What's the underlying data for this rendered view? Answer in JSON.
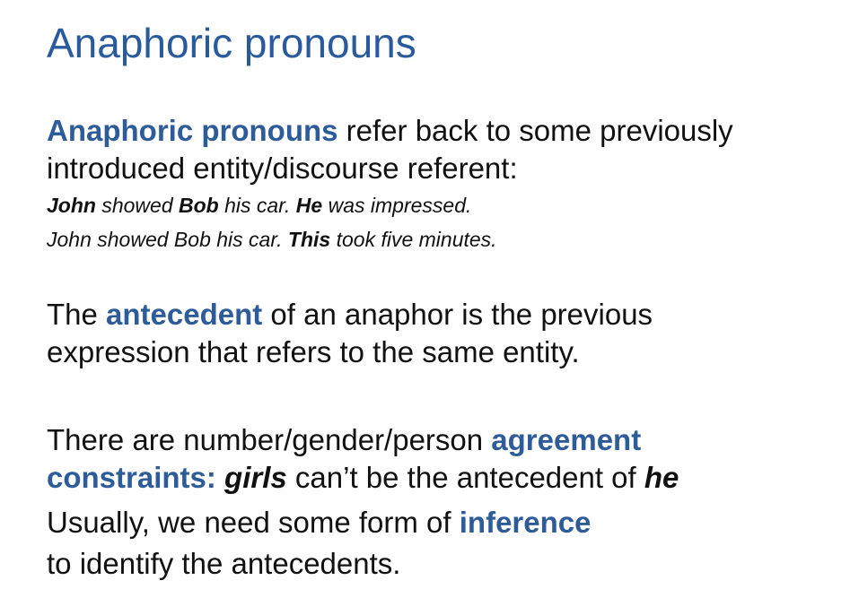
{
  "slide": {
    "title": "Anaphoric pronouns",
    "p1": {
      "term": "Anaphoric pronouns",
      "rest_line1": " refer back to some previously",
      "line2": "introduced entity/discourse referent:"
    },
    "ex1": {
      "w1": "John",
      "w2": " showed ",
      "w3": "Bob",
      "w4": " his car. ",
      "w5": "He",
      "w6": " was impressed."
    },
    "ex2": {
      "w1": "John showed Bob his car. ",
      "w2": "This",
      "w3": " took five minutes."
    },
    "p2": {
      "pre": "The ",
      "term": "antecedent",
      "post": " of an anaphor is the previous",
      "line2": "expression that refers to the same entity."
    },
    "p3": {
      "pre": "There are number/gender/person ",
      "term1": "agreement",
      "term2": "constraints:",
      "space": " ",
      "girls": "girls",
      "mid": " can’t be the antecedent of ",
      "he": "he"
    },
    "p4": {
      "pre": "Usually, we need some form of ",
      "term": "inference",
      "line2": "to identify the antecedents."
    }
  }
}
